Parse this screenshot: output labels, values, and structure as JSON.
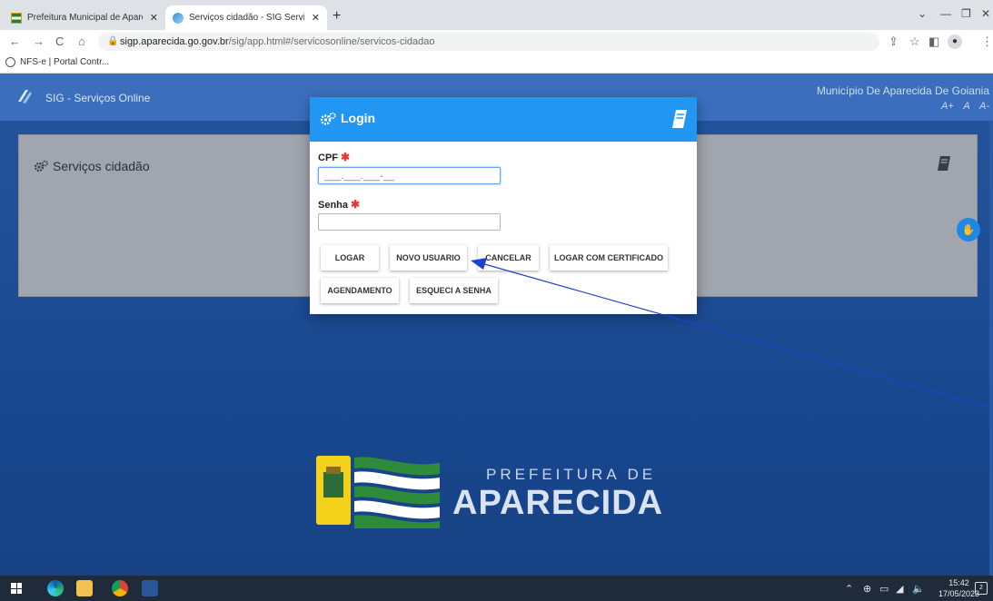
{
  "browser": {
    "tabs": [
      {
        "label": "Prefeitura Municipal de Aparecid",
        "icon": "flag-favicon"
      },
      {
        "label": "Serviços cidadão - SIG Serviços O",
        "icon": "sig-favicon"
      }
    ],
    "new_tab": "+",
    "url_host": "sigp.aparecida.go.gov.br",
    "url_path": "/sig/app.html#/servicosonline/servicos-cidadao",
    "bookmark": "NFS-e | Portal Contr..."
  },
  "app": {
    "title": "SIG - Serviços Online",
    "municipality": "Município De Aparecida De Goiania",
    "font_controls": [
      "A+",
      "A",
      "A-"
    ]
  },
  "card": {
    "title": "Serviços cidadão"
  },
  "login": {
    "title": "Login",
    "cpf_label": "CPF",
    "cpf_value": "___.___.___-__",
    "senha_label": "Senha",
    "required_mark": "✱",
    "buttons": {
      "logar": "LOGAR",
      "novo_usuario": "NOVO USUARIO",
      "cancelar": "CANCELAR",
      "logar_certificado": "LOGAR COM CERTIFICADO",
      "agendamento": "AGENDAMENTO",
      "esqueci_senha": "ESQUECI A SENHA"
    }
  },
  "brand": {
    "line1": "PREFEITURA DE",
    "line2": "APARECIDA"
  },
  "taskbar": {
    "time": "15:42",
    "date": "17/05/2023",
    "notifications": "2"
  },
  "colors": {
    "modal_header": "#2196f3",
    "page_blue": "#1d52a0",
    "annotation_arrow": "#1e40d0"
  }
}
